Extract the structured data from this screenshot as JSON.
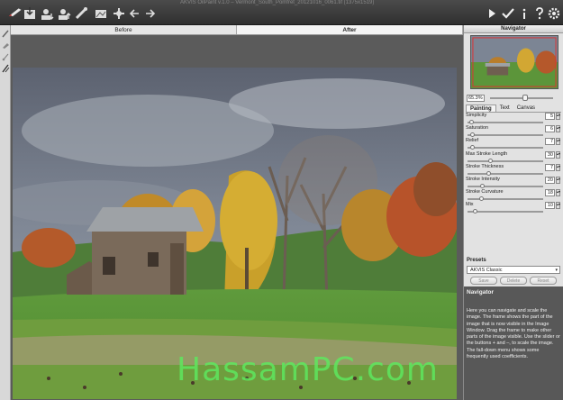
{
  "window": {
    "title": "AKVIS OilPaint v.1.0 – Vermont_South_Pomfret_20121016_0061.tif (1375x1519)"
  },
  "toolbar": {
    "left_icons": [
      "logo-brush-icon",
      "open-icon",
      "save-icon",
      "print-icon",
      "share-icon",
      "eraser-icon",
      "image-icon",
      "settings-icon",
      "undo-icon",
      "redo-icon"
    ],
    "right_icons": [
      "run-icon",
      "apply-icon",
      "info-icon",
      "help-icon",
      "preferences-icon"
    ]
  },
  "view_tabs": {
    "before": "Before",
    "after": "After"
  },
  "navigator": {
    "title": "Navigator",
    "zoom": "65.3%",
    "zoom_fraction": 0.55
  },
  "parameter_tabs": [
    "Painting",
    "Text",
    "Canvas"
  ],
  "parameters": [
    {
      "label": "Simplicity",
      "value": "5",
      "fraction": 0.05
    },
    {
      "label": "Saturation",
      "value": "6",
      "fraction": 0.06
    },
    {
      "label": "Relief",
      "value": "7",
      "fraction": 0.07
    },
    {
      "label": "Max Stroke Length",
      "value": "30",
      "fraction": 0.3
    },
    {
      "label": "Stroke Thickness",
      "value": "7",
      "fraction": 0.28
    },
    {
      "label": "Stroke Intensity",
      "value": "20",
      "fraction": 0.2
    },
    {
      "label": "Stroke Curvature",
      "value": "18",
      "fraction": 0.18
    },
    {
      "label": "Mix",
      "value": "10",
      "fraction": 0.1
    }
  ],
  "presets": {
    "label": "Presets",
    "selected": "AKVIS Classic",
    "save": "Save",
    "delete": "Delete",
    "reset": "Reset"
  },
  "help": {
    "title": "Navigator",
    "text": "Here you can navigate and scale the image. The frame shows the part of the image that is now visible in the Image Window. Drag the frame to make other parts of the image visible. Use the slider or the buttons + and –, to scale the image. The fall-down menu shows some frequently used coefficients."
  },
  "watermark": "HassamPC.com",
  "colors": {
    "toolbar": "#3a3a3a",
    "panel": "#e2e2e2",
    "help_bg": "#585858",
    "watermark": "#5ee85e"
  }
}
